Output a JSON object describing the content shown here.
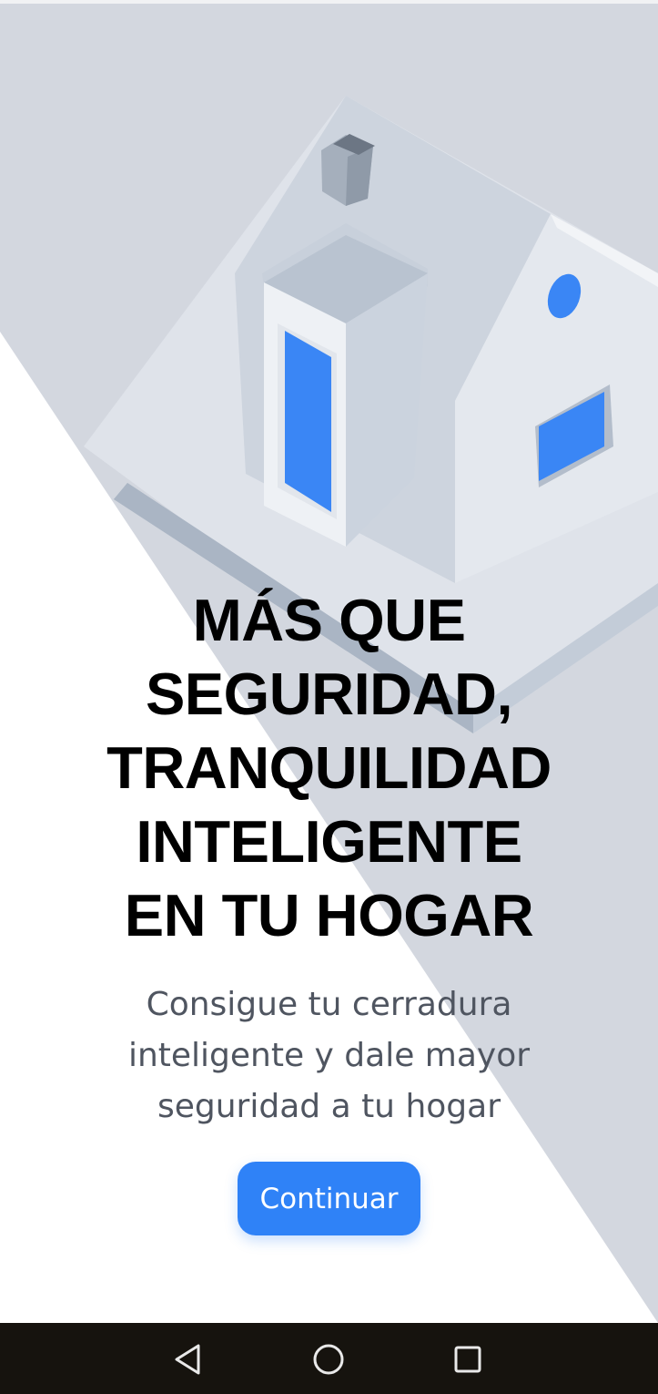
{
  "onboarding": {
    "headline_lines": [
      "MÁS QUE",
      "SEGURIDAD,",
      "TRANQUILIDAD",
      "INTELIGENTE",
      "EN TU HOGAR"
    ],
    "subtitle_lines": [
      "Consigue tu cerradura",
      "inteligente y dale mayor",
      "seguridad a tu hogar"
    ],
    "continue_label": "Continuar"
  },
  "navigation_bar": {
    "back_icon": "triangle-back-icon",
    "home_icon": "circle-home-icon",
    "recents_icon": "square-recents-icon"
  },
  "colors": {
    "accent": "#2f82f7",
    "illustration_window": "#3a86f5",
    "background_panel": "#d3d7df",
    "nav_bar": "#16130e",
    "headline": "#000000",
    "subtitle": "#4f5560"
  }
}
